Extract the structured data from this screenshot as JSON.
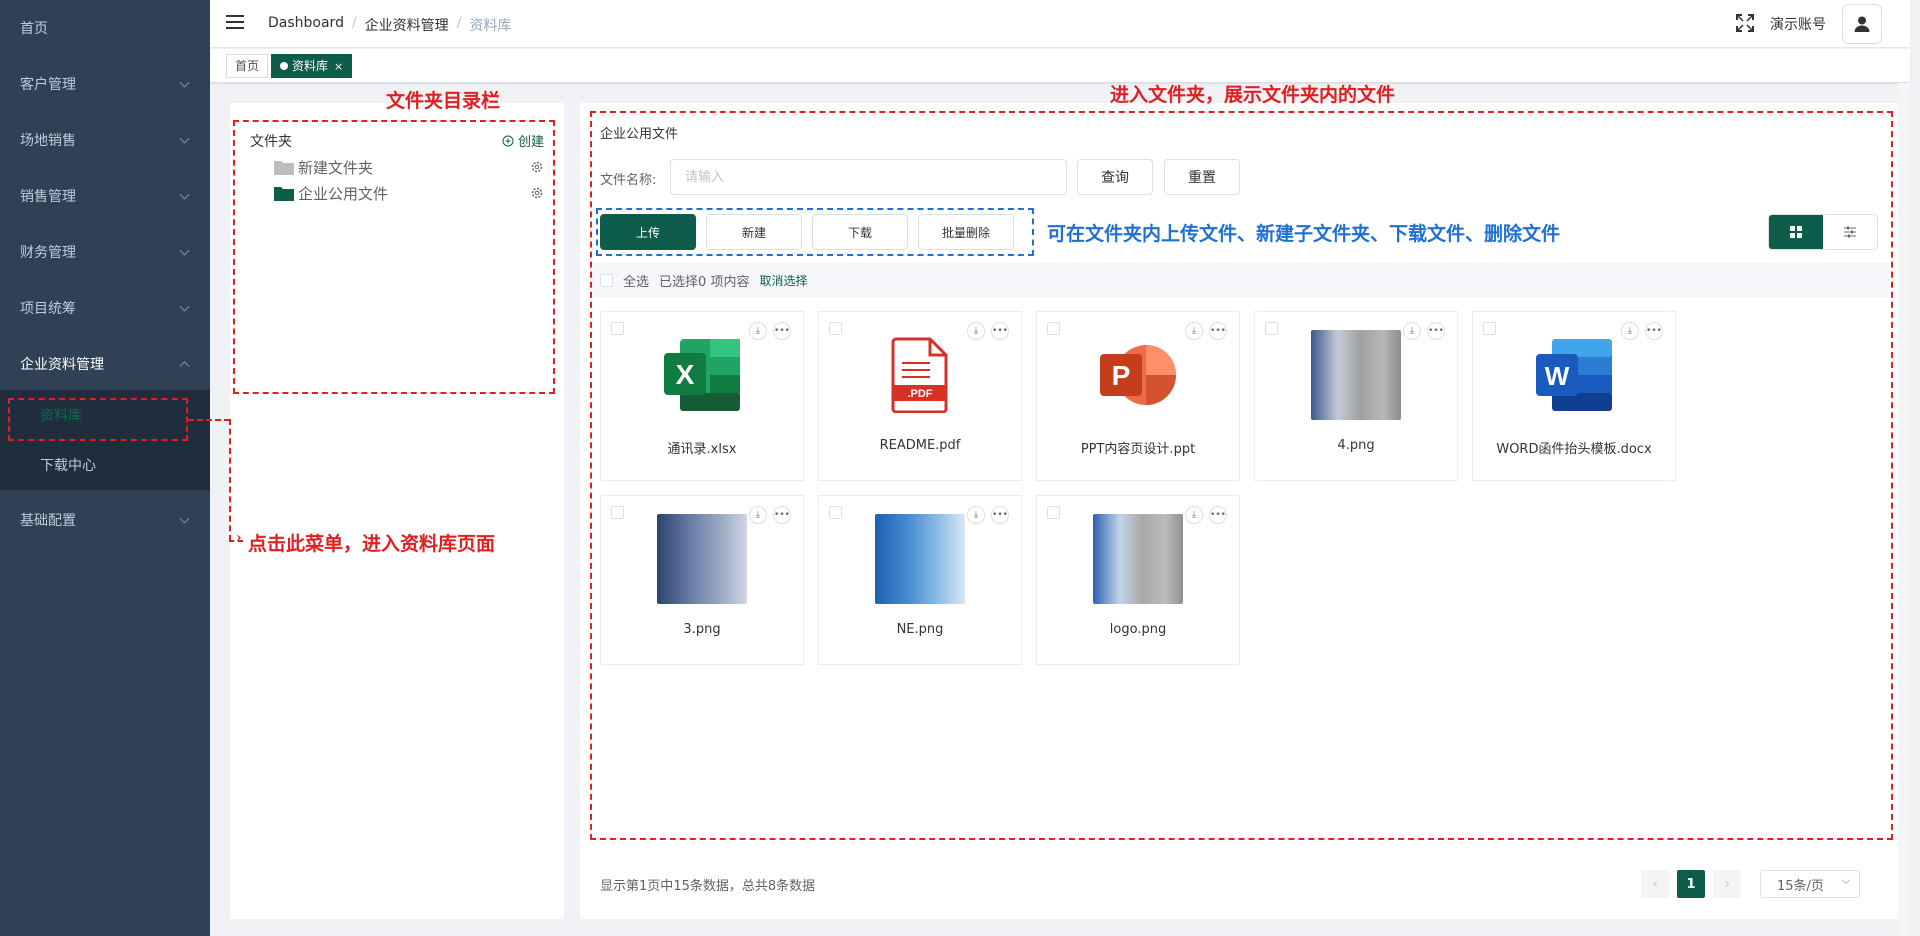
{
  "sidebar": {
    "items": [
      {
        "label": "首页"
      },
      {
        "label": "客户管理"
      },
      {
        "label": "场地销售"
      },
      {
        "label": "销售管理"
      },
      {
        "label": "财务管理"
      },
      {
        "label": "项目统筹"
      },
      {
        "label": "企业资料管理"
      },
      {
        "label": "基础配置"
      }
    ],
    "submenu": [
      {
        "label": "资料库"
      },
      {
        "label": "下载中心"
      }
    ]
  },
  "header": {
    "breadcrumb": [
      "Dashboard",
      "企业资料管理",
      "资料库"
    ],
    "account": "演示账号"
  },
  "tags": [
    {
      "label": "首页"
    },
    {
      "label": "资料库"
    }
  ],
  "tree": {
    "title": "文件夹",
    "create_label": "创建",
    "nodes": [
      {
        "label": "新建文件夹",
        "color": "#bdbdbd"
      },
      {
        "label": "企业公用文件",
        "color": "#0e5c4a"
      }
    ]
  },
  "main": {
    "folder_title": "企业公用文件",
    "search": {
      "label": "文件名称:",
      "placeholder": "请输入"
    },
    "query_btn": "查询",
    "reset_btn": "重置",
    "actions": [
      "上传",
      "新建",
      "下载",
      "批量删除"
    ],
    "select_all": "全选",
    "selected_prefix": "已选择",
    "selected_count": "0",
    "selected_suffix": "项内容",
    "cancel_select": "取消选择",
    "files": [
      {
        "name": "通讯录.xlsx",
        "icon": "excel-icon"
      },
      {
        "name": "README.pdf",
        "icon": "pdf-icon"
      },
      {
        "name": "PPT内容页设计.ppt",
        "icon": "powerpoint-icon"
      },
      {
        "name": "4.png",
        "icon": "image-thumbnail"
      },
      {
        "name": "WORD函件抬头模板.docx",
        "icon": "word-icon"
      },
      {
        "name": "3.png",
        "icon": "image-thumbnail"
      },
      {
        "name": "NE.png",
        "icon": "image-thumbnail"
      },
      {
        "name": "logo.png",
        "icon": "image-thumbnail"
      }
    ],
    "footer": {
      "info_a": "显示第",
      "page": "1",
      "info_b": "页中",
      "page_size": "15",
      "info_c": "条数据，总共",
      "total": "8",
      "info_d": "条数据"
    },
    "pagination": {
      "current": "1",
      "size_label": "15条/页"
    }
  },
  "annotations": {
    "folder_tree": "文件夹目录栏",
    "folder_content": "进入文件夹，展示文件夹内的文件",
    "actions_note": "可在文件夹内上传文件、新建子文件夹、下载文件、删除文件",
    "menu_note": "点击此菜单，进入资料库页面"
  },
  "colors": {
    "primary": "#0e5c4a",
    "sidebar_bg": "#304156",
    "annotation_red": "#e02020",
    "annotation_blue": "#1f6fd6"
  }
}
